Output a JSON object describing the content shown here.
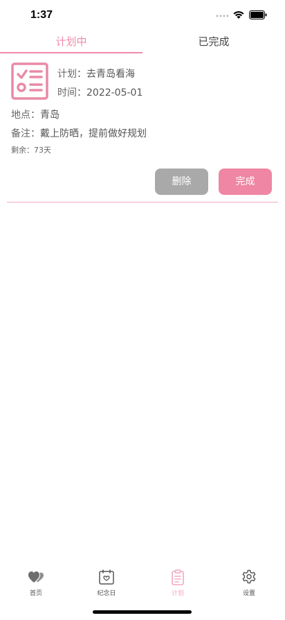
{
  "status_bar": {
    "time": "1:37"
  },
  "tabs": [
    {
      "label": "计划中",
      "active": true
    },
    {
      "label": "已完成",
      "active": false
    }
  ],
  "plan": {
    "icon": "checklist-icon",
    "title_label": "计划：",
    "title_value": "去青岛看海",
    "date_label": "时间：",
    "date_value": "2022-05-01",
    "location_label": "地点：",
    "location_value": "青岛",
    "note_label": "备注：",
    "note_value": "戴上防晒，提前做好规划",
    "remaining_label": "剩余：",
    "remaining_value": "73天",
    "delete_label": "删除",
    "complete_label": "完成"
  },
  "nav": [
    {
      "label": "首页",
      "icon": "hearts-icon",
      "active": false
    },
    {
      "label": "纪念日",
      "icon": "calendar-heart-icon",
      "active": false
    },
    {
      "label": "计划",
      "icon": "clipboard-icon",
      "active": true
    },
    {
      "label": "设置",
      "icon": "gear-icon",
      "active": false
    }
  ],
  "colors": {
    "accent": "#f08aa8",
    "delete_button": "#a9a9a9",
    "complete_button": "#ef86a3",
    "nav_active": "#f3a9bf"
  }
}
